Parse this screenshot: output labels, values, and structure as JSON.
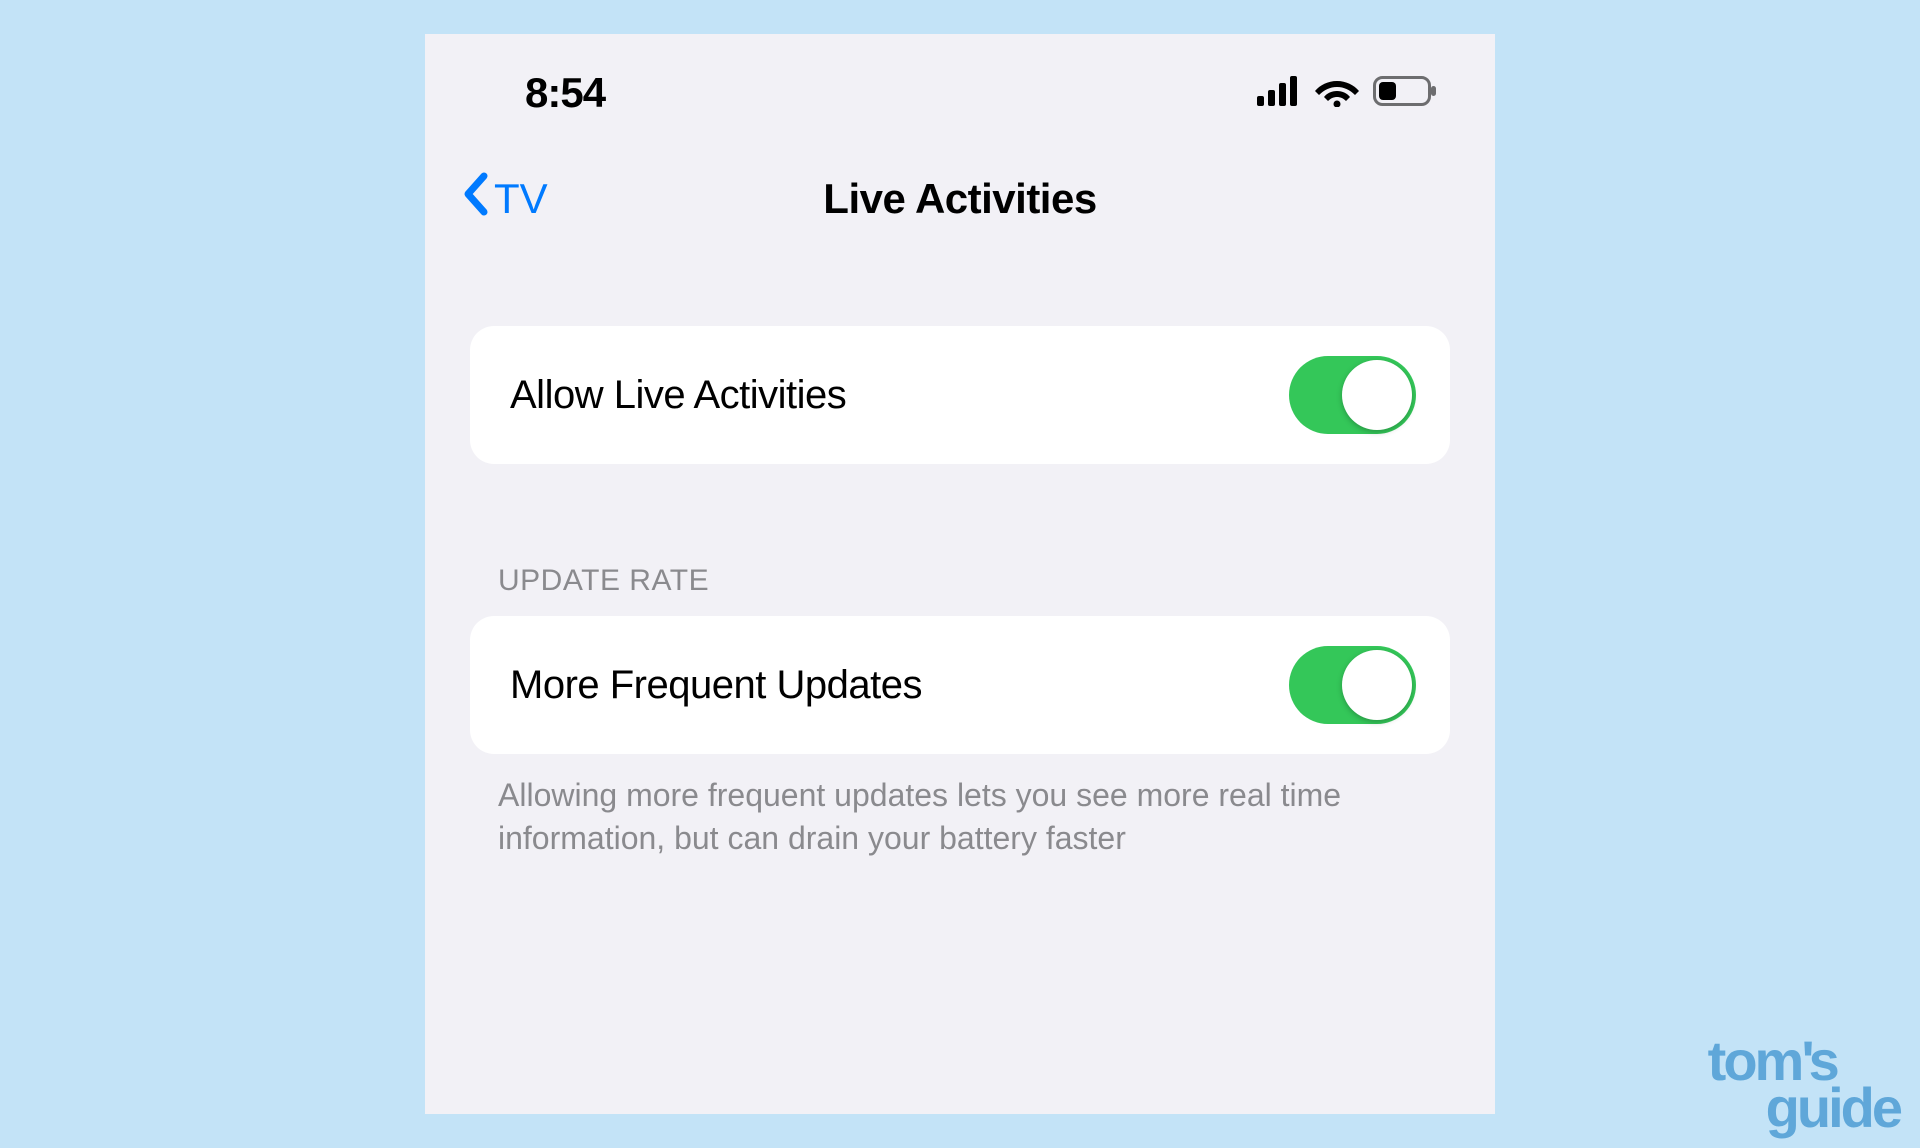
{
  "status": {
    "time": "8:54"
  },
  "nav": {
    "back_label": "TV",
    "title": "Live Activities"
  },
  "groups": [
    {
      "rows": [
        {
          "label": "Allow Live Activities",
          "toggle": true
        }
      ]
    },
    {
      "header": "UPDATE RATE",
      "rows": [
        {
          "label": "More Frequent Updates",
          "toggle": true
        }
      ],
      "footer": "Allowing more frequent updates lets you see more real time information, but can drain your battery faster"
    }
  ],
  "watermark": {
    "line1": "tom's",
    "line2": "guide"
  }
}
